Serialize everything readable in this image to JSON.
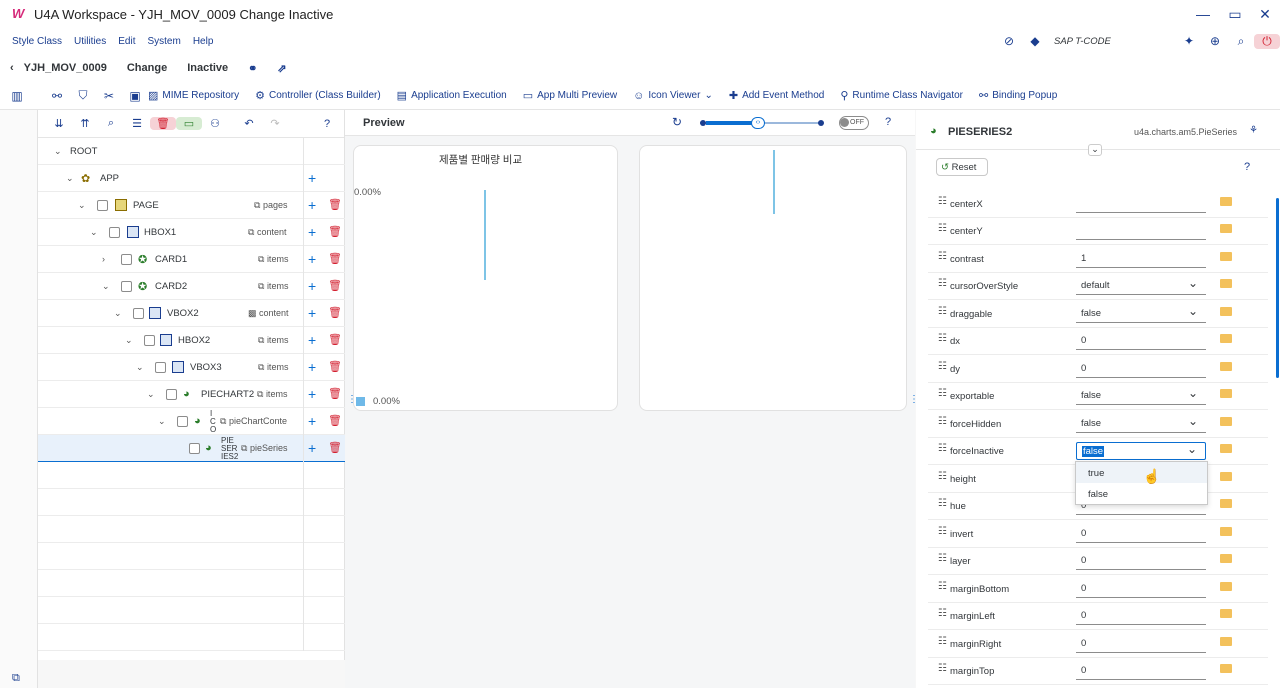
{
  "window": {
    "title": "U4A Workspace - YJH_MOV_0009 Change Inactive",
    "logo": "W"
  },
  "menu": {
    "items": [
      "Style Class",
      "Utilities",
      "Edit",
      "System",
      "Help"
    ],
    "tcode_label": "SAP T-CODE"
  },
  "subheader": {
    "app_id": "YJH_MOV_0009",
    "mode": "Change",
    "status": "Inactive"
  },
  "toolbar": {
    "buttons": [
      "MIME Repository",
      "Controller (Class Builder)",
      "Application Execution",
      "App Multi Preview",
      "Icon Viewer",
      "Add Event Method",
      "Runtime Class Navigator",
      "Binding Popup"
    ]
  },
  "tree": {
    "rows": [
      {
        "label": "ROOT",
        "agg": ""
      },
      {
        "label": "APP",
        "agg": ""
      },
      {
        "label": "PAGE",
        "agg": "pages"
      },
      {
        "label": "HBOX1",
        "agg": "content"
      },
      {
        "label": "CARD1",
        "agg": "items"
      },
      {
        "label": "CARD2",
        "agg": "items"
      },
      {
        "label": "VBOX2",
        "agg": "content"
      },
      {
        "label": "HBOX2",
        "agg": "items"
      },
      {
        "label": "VBOX3",
        "agg": "items"
      },
      {
        "label": "PIECHART2",
        "agg": "items"
      },
      {
        "label": "I C O",
        "agg": "pieChartConte"
      },
      {
        "label": "PIE SER IES2",
        "agg": "pieSeries"
      }
    ]
  },
  "preview": {
    "title": "Preview",
    "toggle": "OFF",
    "chart_title": "제품별 판매량 비교",
    "label_top": "0.00%",
    "legend_value": "0.00%"
  },
  "props": {
    "name": "PIESERIES2",
    "class": "u4a.charts.am5.PieSeries",
    "reset_label": "Reset",
    "rows": [
      {
        "label": "centerX",
        "value": "",
        "dropdown": false
      },
      {
        "label": "centerY",
        "value": "",
        "dropdown": false
      },
      {
        "label": "contrast",
        "value": "1",
        "dropdown": false
      },
      {
        "label": "cursorOverStyle",
        "value": "default",
        "dropdown": true
      },
      {
        "label": "draggable",
        "value": "false",
        "dropdown": true
      },
      {
        "label": "dx",
        "value": "0",
        "dropdown": false
      },
      {
        "label": "dy",
        "value": "0",
        "dropdown": false
      },
      {
        "label": "exportable",
        "value": "false",
        "dropdown": true
      },
      {
        "label": "forceHidden",
        "value": "false",
        "dropdown": true
      },
      {
        "label": "forceInactive",
        "value": "false",
        "dropdown": true
      },
      {
        "label": "height",
        "value": "",
        "dropdown": false
      },
      {
        "label": "hue",
        "value": "0",
        "dropdown": false
      },
      {
        "label": "invert",
        "value": "0",
        "dropdown": false
      },
      {
        "label": "layer",
        "value": "0",
        "dropdown": false
      },
      {
        "label": "marginBottom",
        "value": "0",
        "dropdown": false
      },
      {
        "label": "marginLeft",
        "value": "0",
        "dropdown": false
      },
      {
        "label": "marginRight",
        "value": "0",
        "dropdown": false
      },
      {
        "label": "marginTop",
        "value": "0",
        "dropdown": false
      }
    ],
    "dropdown_options": [
      "true",
      "false"
    ]
  },
  "colors": {
    "accent": "#0a6ed1",
    "delete": "#d32030",
    "folder": "#f3c15c"
  }
}
